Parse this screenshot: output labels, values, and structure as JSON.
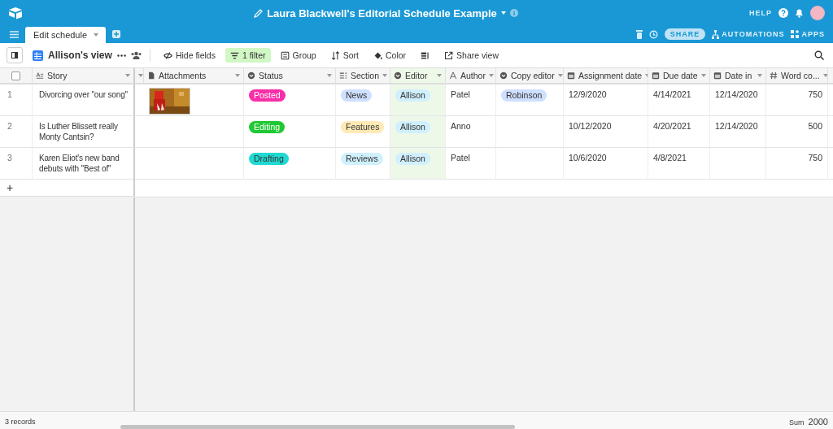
{
  "app": {
    "title": "Laura Blackwell's Editorial Schedule Example",
    "help": "HELP",
    "share": "SHARE",
    "automations": "AUTOMATIONS",
    "apps": "APPS"
  },
  "tabs": [
    {
      "label": "Edit schedule",
      "selected": true
    }
  ],
  "toolbar": {
    "view_name": "Allison's view",
    "buttons": [
      {
        "label": "Hide fields",
        "kind": "hide",
        "active": false
      },
      {
        "label": "1 filter",
        "kind": "filter",
        "active": true
      },
      {
        "label": "Group",
        "kind": "group",
        "active": false
      },
      {
        "label": "Sort",
        "kind": "sort",
        "active": false
      },
      {
        "label": "Color",
        "kind": "color",
        "active": false
      },
      {
        "kind": "height",
        "active": false
      },
      {
        "label": "Share view",
        "kind": "share",
        "active": false
      }
    ]
  },
  "table": {
    "select_all": {
      "checked": false
    },
    "columns": [
      {
        "label": "Story",
        "kind": "longtext",
        "filtered": false
      },
      {
        "label": "Attachments",
        "kind": "attachment",
        "filtered": false
      },
      {
        "label": "Status",
        "kind": "select",
        "filtered": false
      },
      {
        "label": "Section",
        "kind": "multiselect",
        "filtered": false
      },
      {
        "label": "Editor",
        "kind": "select",
        "filtered": true
      },
      {
        "label": "Author",
        "kind": "text",
        "filtered": false
      },
      {
        "label": "Copy editor",
        "kind": "select",
        "filtered": false
      },
      {
        "label": "Assignment date",
        "kind": "date",
        "filtered": false
      },
      {
        "label": "Due date",
        "kind": "date",
        "filtered": false
      },
      {
        "label": "Date in",
        "kind": "date",
        "filtered": false
      },
      {
        "label": "Word co...",
        "kind": "number",
        "filtered": false
      }
    ],
    "rows": [
      {
        "number": "1",
        "cells": [
          {
            "kind": "text",
            "text": "Divorcing over \"our song\""
          },
          {
            "kind": "picture"
          },
          {
            "kind": "tag",
            "text": "Posted",
            "color": "#f82fa8"
          },
          {
            "kind": "tag",
            "text": "News",
            "color": "#cfdfff"
          },
          {
            "kind": "tag",
            "text": "Allison",
            "color": "#d0f0fd"
          },
          {
            "kind": "text",
            "text": "Patel"
          },
          {
            "kind": "tag",
            "text": "Robinson",
            "color": "#cfdfff"
          },
          {
            "kind": "text",
            "text": "12/9/2020"
          },
          {
            "kind": "text",
            "text": "4/14/2021"
          },
          {
            "kind": "text",
            "text": "12/14/2020"
          },
          {
            "kind": "number",
            "text": "750"
          }
        ]
      },
      {
        "number": "2",
        "cells": [
          {
            "kind": "text",
            "text": "Is Luther Blissett really Monty Cantsin?"
          },
          null,
          {
            "kind": "tag",
            "text": "Editing",
            "color": "#20c933"
          },
          {
            "kind": "tag",
            "text": "Features",
            "color": "#ffeab6"
          },
          {
            "kind": "tag",
            "text": "Allison",
            "color": "#d0f0fd"
          },
          {
            "kind": "text",
            "text": "Anno"
          },
          null,
          {
            "kind": "text",
            "text": "10/12/2020"
          },
          {
            "kind": "text",
            "text": "4/20/2021"
          },
          {
            "kind": "text",
            "text": "12/14/2020"
          },
          {
            "kind": "number",
            "text": "500"
          }
        ]
      },
      {
        "number": "3",
        "cells": [
          {
            "kind": "text",
            "text": "Karen Eliot's new band debuts with \"Best of\""
          },
          null,
          {
            "kind": "tag",
            "text": "Drafting",
            "color": "#20d9d2"
          },
          {
            "kind": "tag",
            "text": "Reviews",
            "color": "#d0f0fd"
          },
          {
            "kind": "tag",
            "text": "Allison",
            "color": "#d0f0fd"
          },
          {
            "kind": "text",
            "text": "Patel"
          },
          null,
          {
            "kind": "text",
            "text": "10/6/2020"
          },
          {
            "kind": "text",
            "text": "4/8/2021"
          },
          null,
          {
            "kind": "number",
            "text": "750"
          }
        ]
      }
    ],
    "add_row": "+"
  },
  "footer": {
    "records": "3 records",
    "sum_label": "Sum",
    "sum_value": "2000"
  }
}
